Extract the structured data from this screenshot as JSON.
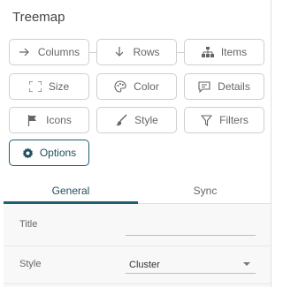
{
  "panel": {
    "title": "Treemap"
  },
  "buttons": {
    "columns": {
      "label": "Columns",
      "icon": "arrow-right-icon"
    },
    "rows": {
      "label": "Rows",
      "icon": "arrow-down-icon"
    },
    "items": {
      "label": "Items",
      "icon": "hierarchy-icon"
    },
    "size": {
      "label": "Size",
      "icon": "resize-icon"
    },
    "color": {
      "label": "Color",
      "icon": "palette-icon"
    },
    "details": {
      "label": "Details",
      "icon": "comment-icon"
    },
    "icons": {
      "label": "Icons",
      "icon": "flag-icon"
    },
    "style": {
      "label": "Style",
      "icon": "paintbrush-icon"
    },
    "filters": {
      "label": "Filters",
      "icon": "filter-icon"
    },
    "options": {
      "label": "Options",
      "icon": "gear-icon"
    }
  },
  "tabs": [
    {
      "label": "General",
      "active": true
    },
    {
      "label": "Sync",
      "active": false
    }
  ],
  "settings": {
    "title": {
      "label": "Title",
      "value": ""
    },
    "style": {
      "label": "Style",
      "value": "Cluster"
    }
  },
  "colors": {
    "accent": "#1f5f72",
    "border": "#cfcfcf"
  }
}
